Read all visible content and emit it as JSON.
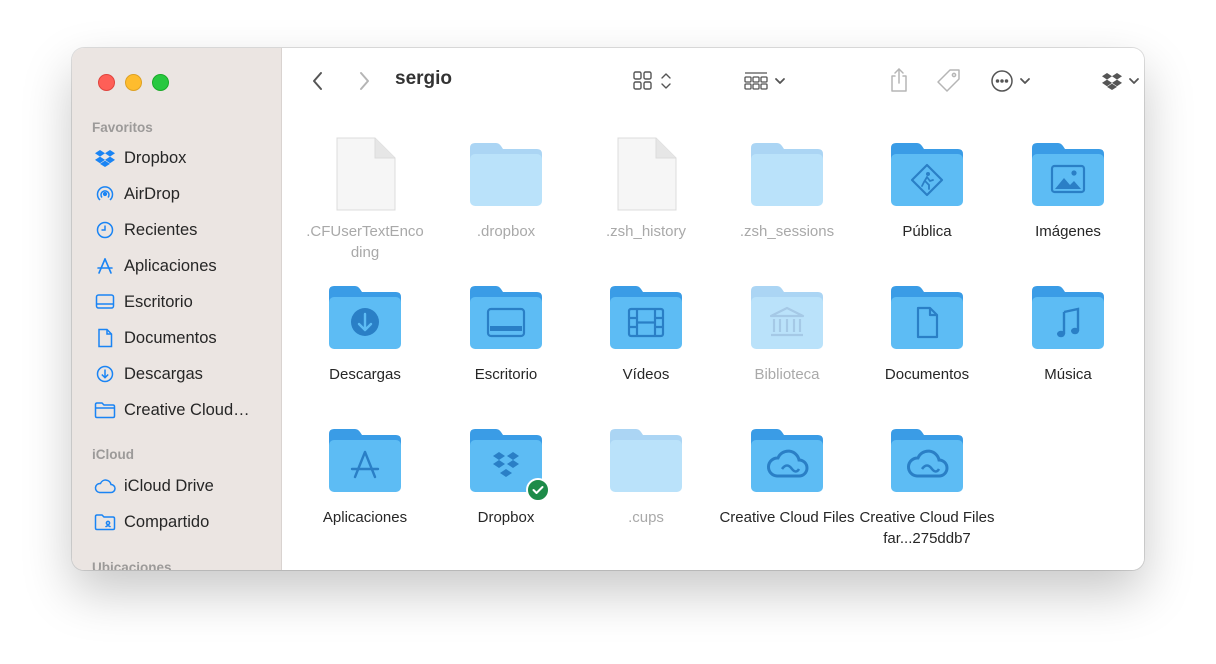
{
  "window": {
    "title": "sergio"
  },
  "sidebar": {
    "favorites_heading": "Favoritos",
    "favorites": [
      {
        "label": "Dropbox",
        "icon": "dropbox-icon"
      },
      {
        "label": "AirDrop",
        "icon": "airdrop-icon"
      },
      {
        "label": "Recientes",
        "icon": "clock-icon"
      },
      {
        "label": "Aplicaciones",
        "icon": "applications-icon"
      },
      {
        "label": "Escritorio",
        "icon": "desktop-icon"
      },
      {
        "label": "Documentos",
        "icon": "document-icon"
      },
      {
        "label": "Descargas",
        "icon": "download-icon"
      },
      {
        "label": "Creative Cloud…",
        "icon": "folder-icon"
      }
    ],
    "icloud_heading": "iCloud",
    "icloud": [
      {
        "label": "iCloud Drive",
        "icon": "cloud-icon"
      },
      {
        "label": "Compartido",
        "icon": "shared-folder-icon"
      }
    ],
    "locations_heading": "Ubicaciones"
  },
  "files": [
    {
      "name": ".CFUserTextEnco ding",
      "kind": "file",
      "dim": true
    },
    {
      "name": ".dropbox",
      "kind": "folder",
      "dim": true
    },
    {
      "name": ".zsh_history",
      "kind": "file",
      "dim": true
    },
    {
      "name": ".zsh_sessions",
      "kind": "folder",
      "dim": true
    },
    {
      "name": "Pública",
      "kind": "folder",
      "glyph": "public-icon"
    },
    {
      "name": "Imágenes",
      "kind": "folder",
      "glyph": "picture-icon"
    },
    {
      "name": "Descargas",
      "kind": "folder",
      "glyph": "download-icon"
    },
    {
      "name": "Escritorio",
      "kind": "folder",
      "glyph": "desktop-icon"
    },
    {
      "name": "Vídeos",
      "kind": "folder",
      "glyph": "film-icon"
    },
    {
      "name": "Biblioteca",
      "kind": "folder",
      "glyph": "library-icon",
      "dim": true
    },
    {
      "name": "Documentos",
      "kind": "folder",
      "glyph": "document-icon"
    },
    {
      "name": "Música",
      "kind": "folder",
      "glyph": "music-icon"
    },
    {
      "name": "Aplicaciones",
      "kind": "folder",
      "glyph": "applications-icon"
    },
    {
      "name": "Dropbox",
      "kind": "folder",
      "glyph": "dropbox-icon",
      "badge": "synced-check-icon"
    },
    {
      "name": ".cups",
      "kind": "folder",
      "dim": true
    },
    {
      "name": "Creative Cloud Files",
      "kind": "folder",
      "glyph": "creative-cloud-icon"
    },
    {
      "name": "Creative Cloud Files far...275ddb7",
      "kind": "folder",
      "glyph": "creative-cloud-icon"
    }
  ],
  "colors": {
    "sidebar_bg": "#ebe5e2",
    "accent_icon": "#1a84f4",
    "folder_front": "#5dbcf4",
    "folder_tab": "#3a9ce6",
    "folder_glyph": "#2a7fc6",
    "dim_label": "#a9a9a9",
    "badge": "#1d8b49"
  }
}
